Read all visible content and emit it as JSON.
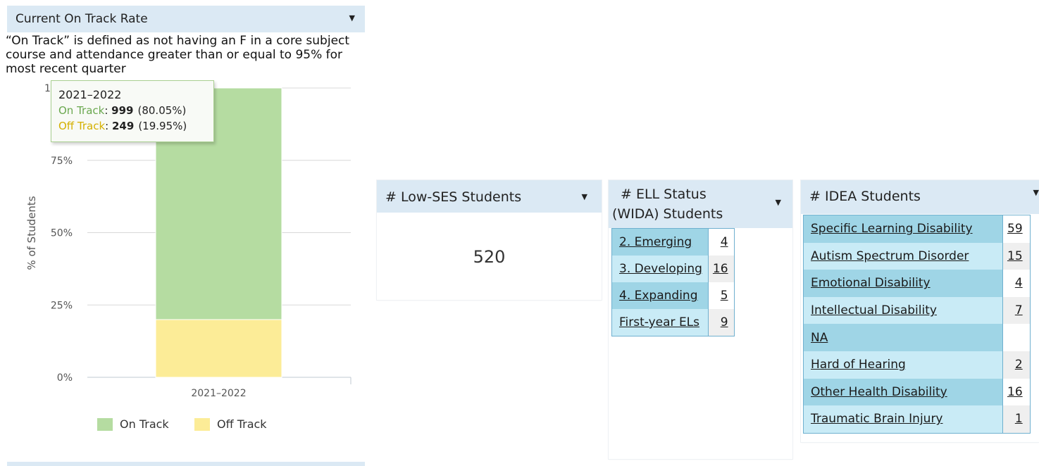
{
  "on_track": {
    "title": "Current On Track Rate",
    "description": "“On Track” is defined as not having an F in a core subject course and attendance greater than or equal to 95% for most recent quarter",
    "tooltip": {
      "title": "2021–2022",
      "on_label": "On Track",
      "on_value": "999",
      "on_pct": "(80.05%)",
      "off_label": "Off Track",
      "off_value": "249",
      "off_pct": "(19.95%)"
    },
    "legend": {
      "on": "On Track",
      "off": "Off Track"
    },
    "colors": {
      "on": "#b5dca1",
      "off": "#fcec97",
      "grid": "#d8d8d8"
    }
  },
  "chart_data": {
    "type": "bar",
    "stacked": true,
    "categories": [
      "2021–2022"
    ],
    "series": [
      {
        "name": "On Track",
        "values": [
          80.05
        ]
      },
      {
        "name": "Off Track",
        "values": [
          19.95
        ]
      }
    ],
    "ylabel": "% of Students",
    "yticks": [
      "0%",
      "25%",
      "50%",
      "75%",
      "100%"
    ],
    "ylim": [
      0,
      100
    ],
    "grid": true,
    "legend_position": "bottom"
  },
  "low_ses": {
    "title": "# Low-SES Students",
    "value": "520"
  },
  "ell": {
    "title_line1": "# ELL Status",
    "title_line2": "(WIDA) Students",
    "rows": [
      {
        "label": "2. Emerging",
        "value": "4"
      },
      {
        "label": "3. Developing",
        "value": "16"
      },
      {
        "label": "4. Expanding",
        "value": "5"
      },
      {
        "label": "First-year ELs",
        "value": "9"
      }
    ]
  },
  "idea": {
    "title": "# IDEA Students",
    "rows": [
      {
        "label": "Specific Learning Disability",
        "value": "59"
      },
      {
        "label": "Autism Spectrum Disorder",
        "value": "15"
      },
      {
        "label": "Emotional Disability",
        "value": "4"
      },
      {
        "label": "Intellectual Disability",
        "value": "7"
      },
      {
        "label": "NA",
        "value": ""
      },
      {
        "label": "Hard of Hearing",
        "value": "2"
      },
      {
        "label": "Other Health Disability",
        "value": "16"
      },
      {
        "label": "Traumatic Brain Injury",
        "value": "1"
      }
    ]
  }
}
